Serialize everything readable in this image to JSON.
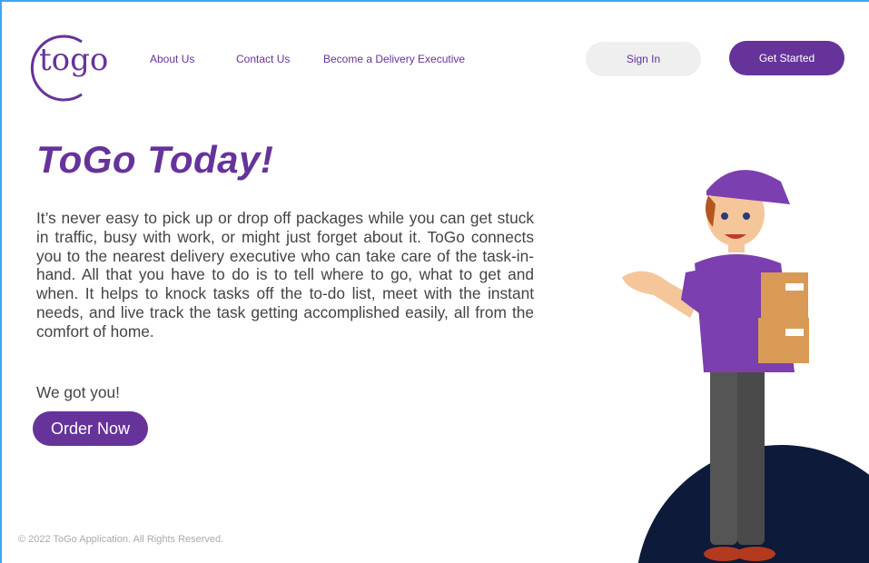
{
  "header": {
    "logo": "togo",
    "nav": [
      "About Us",
      "Contact Us",
      "Become a Delivery Executive"
    ],
    "sign_in": "Sign In",
    "get_started": "Get Started"
  },
  "hero": {
    "title": "ToGo Today!",
    "description": "It’s never easy to pick up or drop off packages while you can get stuck in traffic, busy with work, or might just forget about it. ToGo connects you to the nearest delivery executive who can take care of the task-in-hand. All that you have to do is to tell where to go, what to get and when. It helps to knock tasks off the to-do list, meet with the instant needs, and live track the task getting accomplished easily, all from the comfort of home.",
    "tagline": "We got you!",
    "order_now": "Order Now"
  },
  "footer": {
    "copyright": "© 2022 ToGo Application. All Rights Reserved."
  },
  "colors": {
    "brand": "#66339a",
    "navy": "#0d1a3a"
  }
}
